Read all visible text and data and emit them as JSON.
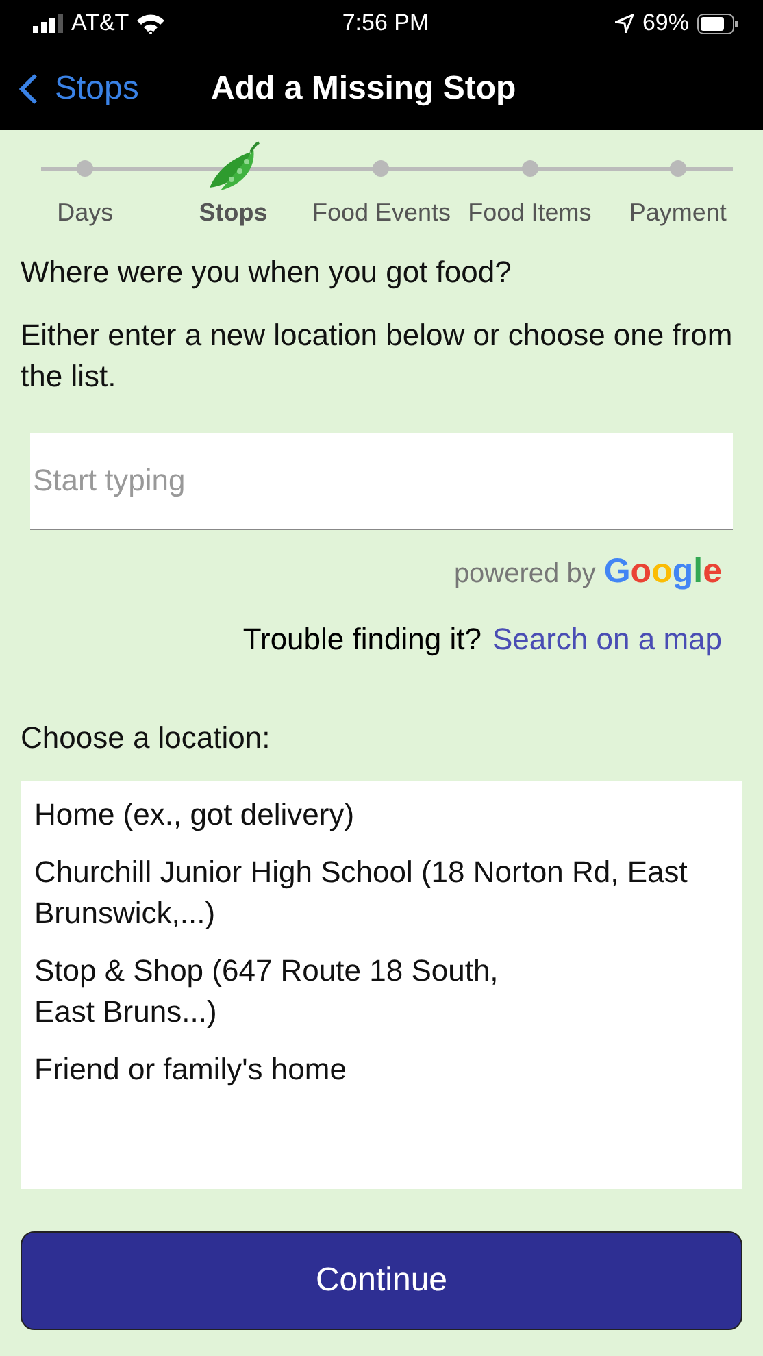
{
  "status_bar": {
    "carrier": "AT&T",
    "time": "7:56 PM",
    "battery": "69%"
  },
  "nav": {
    "back": "Stops",
    "title": "Add a Missing Stop"
  },
  "steps": [
    {
      "label": "Days",
      "selected": false
    },
    {
      "label": "Stops",
      "selected": true
    },
    {
      "label": "Food Events",
      "selected": false
    },
    {
      "label": "Food Items",
      "selected": false
    },
    {
      "label": "Payment",
      "selected": false
    }
  ],
  "question": "Where were you when you got food?",
  "instruction": "Either enter a new location below or choose one from the list.",
  "search": {
    "placeholder": "Start typing"
  },
  "attribution": {
    "text": "powered by",
    "brand": "Google"
  },
  "help": {
    "text": "Trouble finding it?",
    "link": "Search on a map"
  },
  "list_label": "Choose a location:",
  "locations": [
    "Home (ex., got delivery)",
    "Churchill Junior High School (18 Norton Rd, East Brunswick,...)",
    "Stop & Shop (647 Route 18 South,\nEast Bruns...)",
    "Friend or family's home"
  ],
  "continue_button": "Continue"
}
